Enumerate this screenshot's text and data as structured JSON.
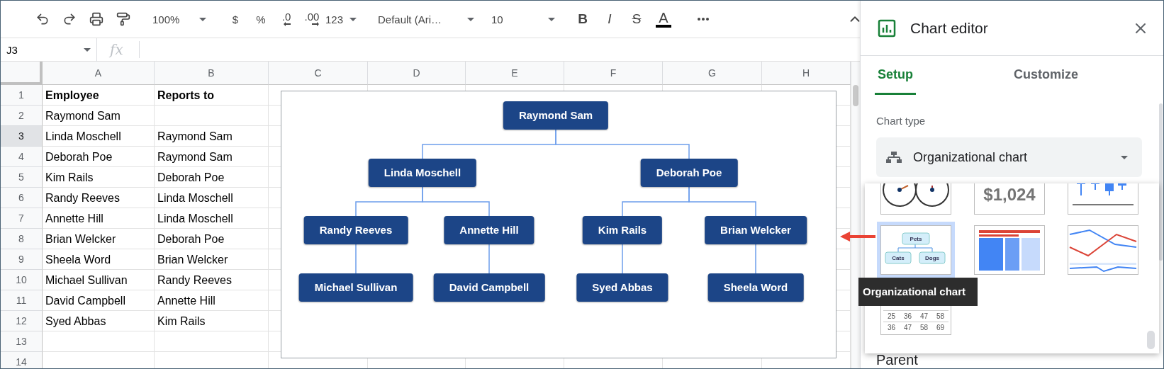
{
  "toolbar": {
    "zoom": "100%",
    "currency": "$",
    "percent": "%",
    "decrease_decimal": ".0",
    "increase_decimal": ".00",
    "number_format": "123",
    "font": "Default (Ari…",
    "font_size": "10",
    "bold": "B",
    "italic": "I",
    "strikethrough": "S",
    "text_color": "A"
  },
  "formula_bar": {
    "cell_ref": "J3",
    "fx": "fx"
  },
  "columns": [
    "A",
    "B",
    "C",
    "D",
    "E",
    "F",
    "G",
    "H"
  ],
  "rows": [
    {
      "number": "1",
      "selected": false,
      "cells": [
        {
          "text": "Employee",
          "bold": true
        },
        {
          "text": "Reports to",
          "bold": true
        }
      ]
    },
    {
      "number": "2",
      "selected": false,
      "cells": [
        {
          "text": "Raymond Sam",
          "bold": false
        }
      ]
    },
    {
      "number": "3",
      "selected": true,
      "cells": [
        {
          "text": "Linda Moschell",
          "bold": false
        },
        {
          "text": "Raymond Sam",
          "bold": false
        }
      ]
    },
    {
      "number": "4",
      "selected": false,
      "cells": [
        {
          "text": "Deborah Poe",
          "bold": false
        },
        {
          "text": "Raymond Sam",
          "bold": false
        }
      ]
    },
    {
      "number": "5",
      "selected": false,
      "cells": [
        {
          "text": "Kim Rails",
          "bold": false
        },
        {
          "text": "Deborah Poe",
          "bold": false
        }
      ]
    },
    {
      "number": "6",
      "selected": false,
      "cells": [
        {
          "text": "Randy Reeves",
          "bold": false
        },
        {
          "text": "Linda Moschell",
          "bold": false
        }
      ]
    },
    {
      "number": "7",
      "selected": false,
      "cells": [
        {
          "text": "Annette Hill",
          "bold": false
        },
        {
          "text": "Linda Moschell",
          "bold": false
        }
      ]
    },
    {
      "number": "8",
      "selected": false,
      "cells": [
        {
          "text": "Brian Welcker",
          "bold": false
        },
        {
          "text": "Deborah Poe",
          "bold": false
        }
      ]
    },
    {
      "number": "9",
      "selected": false,
      "cells": [
        {
          "text": "Sheela Word",
          "bold": false
        },
        {
          "text": "Brian Welcker",
          "bold": false
        }
      ]
    },
    {
      "number": "10",
      "selected": false,
      "cells": [
        {
          "text": "Michael Sullivan",
          "bold": false
        },
        {
          "text": "Randy Reeves",
          "bold": false
        }
      ]
    },
    {
      "number": "11",
      "selected": false,
      "cells": [
        {
          "text": "David Campbell",
          "bold": false
        },
        {
          "text": "Annette Hill",
          "bold": false
        }
      ]
    },
    {
      "number": "12",
      "selected": false,
      "cells": [
        {
          "text": "Syed Abbas",
          "bold": false
        },
        {
          "text": "Kim Rails",
          "bold": false
        }
      ]
    },
    {
      "number": "13",
      "selected": false
    },
    {
      "number": "14",
      "selected": false
    }
  ],
  "org_chart": {
    "root": {
      "name": "Raymond Sam",
      "children": [
        {
          "name": "Linda Moschell",
          "children": [
            {
              "name": "Randy Reeves",
              "children": [
                {
                  "name": "Michael Sullivan"
                }
              ]
            },
            {
              "name": "Annette Hill",
              "children": [
                {
                  "name": "David Campbell"
                }
              ]
            }
          ]
        },
        {
          "name": "Deborah Poe",
          "children": [
            {
              "name": "Kim Rails",
              "children": [
                {
                  "name": "Syed Abbas"
                }
              ]
            },
            {
              "name": "Brian Welcker",
              "children": [
                {
                  "name": "Sheela Word"
                }
              ]
            }
          ]
        }
      ]
    }
  },
  "chart_editor": {
    "title": "Chart editor",
    "tabs": [
      {
        "label": "Setup",
        "selected": true
      },
      {
        "label": "Customize",
        "selected": false
      }
    ],
    "chart_type_label": "Chart type",
    "chart_type": "Organizational chart",
    "gallery": [
      {
        "kind": "gauge",
        "selected": false
      },
      {
        "kind": "scorecard",
        "selected": false,
        "value": "$1,024"
      },
      {
        "kind": "candlestick",
        "selected": false
      },
      {
        "kind": "org",
        "selected": true,
        "labels": [
          "Pets",
          "Cats",
          "Dogs"
        ]
      },
      {
        "kind": "treemap",
        "selected": false
      },
      {
        "kind": "timeline",
        "selected": false
      },
      {
        "kind": "table",
        "selected": false,
        "rows": [
          [
            "25",
            "36",
            "47",
            "58"
          ],
          [
            "36",
            "47",
            "58",
            "69"
          ]
        ]
      }
    ],
    "tooltip": "Organizational chart",
    "next_section": "Parent"
  }
}
